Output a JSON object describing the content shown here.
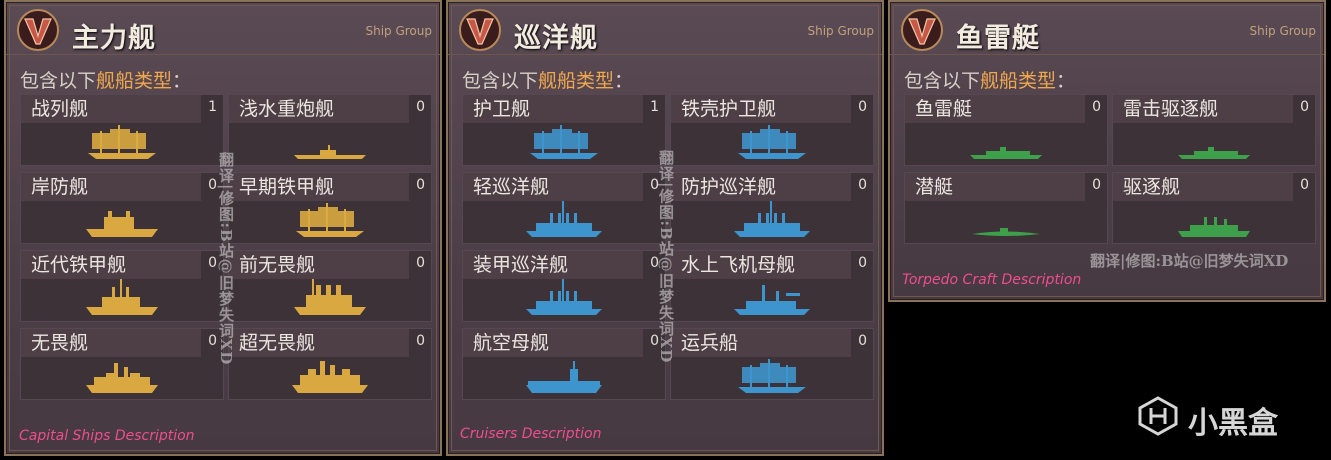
{
  "panels": [
    {
      "title": "主力舰",
      "subtitle": "Ship Group",
      "contains_prefix": "包含以下",
      "contains_highlight": "舰船类型",
      "contains_suffix": "：",
      "description": "Capital Ships Description",
      "color": "#d9a840",
      "cells": [
        {
          "label": "战列舰",
          "count": "1"
        },
        {
          "label": "浅水重炮舰",
          "count": "0"
        },
        {
          "label": "岸防舰",
          "count": "0"
        },
        {
          "label": "早期铁甲舰",
          "count": "0"
        },
        {
          "label": "近代铁甲舰",
          "count": "0"
        },
        {
          "label": "前无畏舰",
          "count": "0"
        },
        {
          "label": "无畏舰",
          "count": "0"
        },
        {
          "label": "超无畏舰",
          "count": "0"
        }
      ]
    },
    {
      "title": "巡洋舰",
      "subtitle": "Ship Group",
      "contains_prefix": "包含以下",
      "contains_highlight": "舰船类型",
      "contains_suffix": "：",
      "description": "Cruisers Description",
      "color": "#3e94cc",
      "cells": [
        {
          "label": "护卫舰",
          "count": "1"
        },
        {
          "label": "铁壳护卫舰",
          "count": "0"
        },
        {
          "label": "轻巡洋舰",
          "count": "0"
        },
        {
          "label": "防护巡洋舰",
          "count": "0"
        },
        {
          "label": "装甲巡洋舰",
          "count": "0"
        },
        {
          "label": "水上飞机母舰",
          "count": "0"
        },
        {
          "label": "航空母舰",
          "count": "0"
        },
        {
          "label": "运兵船",
          "count": "0"
        }
      ]
    },
    {
      "title": "鱼雷艇",
      "subtitle": "Ship Group",
      "contains_prefix": "包含以下",
      "contains_highlight": "舰船类型",
      "contains_suffix": "：",
      "description": "Torpedo Craft Description",
      "color": "#3ea04a",
      "cells": [
        {
          "label": "鱼雷艇",
          "count": "0"
        },
        {
          "label": "雷击驱逐舰",
          "count": "0"
        },
        {
          "label": "潜艇",
          "count": "0"
        },
        {
          "label": "驱逐舰",
          "count": "0"
        }
      ]
    }
  ],
  "watermarks": {
    "vertical": "翻译|修图:B站@旧梦失词XD",
    "horizontal": "翻译|修图:B站@旧梦失词XD"
  },
  "logo": {
    "text": "小黑盒"
  }
}
